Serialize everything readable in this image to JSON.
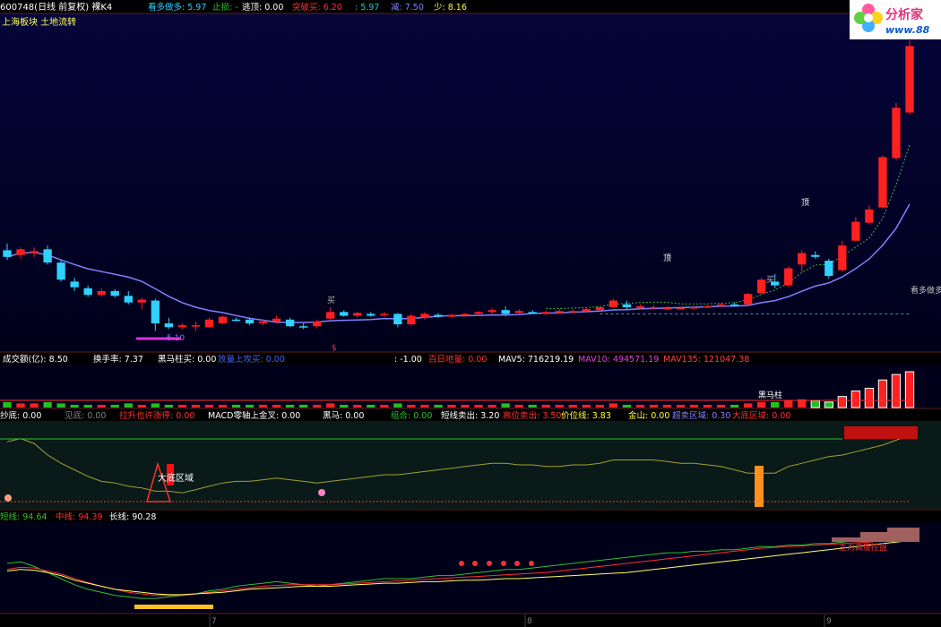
{
  "header": {
    "stock": "600748(日线 前复权) 裸K4",
    "items": [
      {
        "text": "看多做多: 5.97",
        "color": "#30d0ff"
      },
      {
        "text": "止损: -",
        "color": "#30c030"
      },
      {
        "text": "逃顶: 0.00",
        "color": "#ffffff"
      },
      {
        "text": "突破买: 6.20",
        "color": "#ff3030"
      },
      {
        "text": ": 5.97",
        "color": "#30c0c0"
      },
      {
        "text": "减: 7.50",
        "color": "#8080ff"
      },
      {
        "text": "少: 8.16",
        "color": "#ffff40"
      }
    ],
    "sector": "上海板块 土地流转"
  },
  "logo": {
    "line1": "分析家",
    "line2": "www.88"
  },
  "main_annotations": {
    "low_label": "5.10",
    "right_label": "看多做多",
    "top_label": "顶",
    "top_label2": "顶",
    "buy_label": "买",
    "buy_label2": "买",
    "sell_mark": "$"
  },
  "volume_header": [
    {
      "text": "成交额(亿): 8.50",
      "color": "#ffffff"
    },
    {
      "text": "换手率: 7.37",
      "color": "#ffffff"
    },
    {
      "text": "黑马柱买: 0.00",
      "color": "#ffffff"
    },
    {
      "text": "放量上攻买: 0.00",
      "color": "#4060ff"
    },
    {
      "text": ": -1.00",
      "color": "#ffffff"
    },
    {
      "text": "百日地量: 0.00",
      "color": "#ff3030"
    },
    {
      "text": "MAV5: 716219.19",
      "color": "#ffffff"
    },
    {
      "text": "MAV10: 494571.19",
      "color": "#e040e0"
    },
    {
      "text": "MAV135: 121047.38",
      "color": "#ff4040"
    }
  ],
  "volume_annotation": "黑马柱",
  "ind1_header": [
    {
      "text": "抄底: 0.00",
      "color": "#ffffff"
    },
    {
      "text": "见底: 0.00",
      "color": "#808080"
    },
    {
      "text": "拉升也许涨停: 0.00",
      "color": "#ff3030"
    },
    {
      "text": "MACD零轴上金叉: 0.00",
      "color": "#ffffff"
    },
    {
      "text": "黑马: 0.00",
      "color": "#ffffff"
    },
    {
      "text": "组合: 0.00",
      "color": "#30c030"
    },
    {
      "text": "短线卖出: 3.20",
      "color": "#ffffff"
    },
    {
      "text": "高位卖出: 3.50",
      "color": "#ff3030"
    },
    {
      "text": "价位线: 3.83",
      "color": "#ffff40"
    },
    {
      "text": "金山: 0.00",
      "color": "#ffff40"
    },
    {
      "text": "超卖区域: 0.30",
      "color": "#8080ff"
    },
    {
      "text": "大底区域: 0.00",
      "color": "#ff3030"
    }
  ],
  "ind1_annotation": "大底区域",
  "ind2_header": [
    {
      "text": "短线: 94.64",
      "color": "#30c030"
    },
    {
      "text": "中线: 94.39",
      "color": "#ff3030"
    },
    {
      "text": "长线: 90.28",
      "color": "#ffffff"
    }
  ],
  "ind2_annotation": "主力高度控盘",
  "date_ticks": [
    "7",
    "8",
    "9"
  ],
  "colors": {
    "up": "#ff2020",
    "down": "#30d0ff",
    "ma": "#8080ff",
    "bg_top": "#00003a",
    "bg_bottom": "#000000"
  },
  "chart_data": {
    "type": "candlestick",
    "ohlc": [
      [
        5.95,
        6.02,
        5.85,
        5.88
      ],
      [
        5.9,
        5.98,
        5.86,
        5.96
      ],
      [
        5.92,
        5.98,
        5.88,
        5.94
      ],
      [
        5.96,
        6.0,
        5.8,
        5.82
      ],
      [
        5.82,
        5.85,
        5.62,
        5.64
      ],
      [
        5.62,
        5.66,
        5.52,
        5.56
      ],
      [
        5.55,
        5.58,
        5.46,
        5.48
      ],
      [
        5.48,
        5.55,
        5.46,
        5.52
      ],
      [
        5.52,
        5.54,
        5.45,
        5.47
      ],
      [
        5.47,
        5.52,
        5.38,
        5.4
      ],
      [
        5.4,
        5.45,
        5.33,
        5.43
      ],
      [
        5.42,
        5.44,
        5.1,
        5.18
      ],
      [
        5.18,
        5.24,
        5.12,
        5.14
      ],
      [
        5.14,
        5.18,
        5.12,
        5.16
      ],
      [
        5.16,
        5.2,
        5.1,
        5.16
      ],
      [
        5.14,
        5.24,
        5.13,
        5.22
      ],
      [
        5.18,
        5.26,
        5.17,
        5.25
      ],
      [
        5.22,
        5.24,
        5.2,
        5.21
      ],
      [
        5.22,
        5.24,
        5.16,
        5.18
      ],
      [
        5.18,
        5.22,
        5.16,
        5.2
      ],
      [
        5.2,
        5.26,
        5.18,
        5.23
      ],
      [
        5.22,
        5.24,
        5.14,
        5.15
      ],
      [
        5.15,
        5.18,
        5.12,
        5.14
      ],
      [
        5.15,
        5.22,
        5.13,
        5.2
      ],
      [
        5.23,
        5.35,
        5.22,
        5.3
      ],
      [
        5.3,
        5.32,
        5.25,
        5.26
      ],
      [
        5.26,
        5.3,
        5.24,
        5.29
      ],
      [
        5.28,
        5.3,
        5.25,
        5.26
      ],
      [
        5.27,
        5.3,
        5.25,
        5.28
      ],
      [
        5.28,
        5.29,
        5.14,
        5.17
      ],
      [
        5.17,
        5.28,
        5.16,
        5.26
      ],
      [
        5.24,
        5.3,
        5.22,
        5.28
      ],
      [
        5.27,
        5.29,
        5.24,
        5.25
      ],
      [
        5.25,
        5.28,
        5.24,
        5.27
      ],
      [
        5.26,
        5.29,
        5.25,
        5.28
      ],
      [
        5.28,
        5.31,
        5.26,
        5.3
      ],
      [
        5.3,
        5.34,
        5.28,
        5.32
      ],
      [
        5.32,
        5.36,
        5.26,
        5.28
      ],
      [
        5.29,
        5.33,
        5.27,
        5.31
      ],
      [
        5.3,
        5.32,
        5.28,
        5.29
      ],
      [
        5.28,
        5.31,
        5.27,
        5.3
      ],
      [
        5.29,
        5.33,
        5.28,
        5.31
      ],
      [
        5.3,
        5.33,
        5.29,
        5.31
      ],
      [
        5.31,
        5.34,
        5.3,
        5.33
      ],
      [
        5.32,
        5.36,
        5.31,
        5.35
      ],
      [
        5.35,
        5.44,
        5.34,
        5.42
      ],
      [
        5.38,
        5.42,
        5.32,
        5.35
      ],
      [
        5.34,
        5.38,
        5.33,
        5.36
      ],
      [
        5.35,
        5.37,
        5.33,
        5.35
      ],
      [
        5.34,
        5.36,
        5.32,
        5.34
      ],
      [
        5.34,
        5.35,
        5.33,
        5.34
      ],
      [
        5.34,
        5.36,
        5.33,
        5.35
      ],
      [
        5.35,
        5.37,
        5.34,
        5.36
      ],
      [
        5.36,
        5.39,
        5.35,
        5.38
      ],
      [
        5.38,
        5.4,
        5.36,
        5.37
      ],
      [
        5.38,
        5.5,
        5.37,
        5.49
      ],
      [
        5.5,
        5.66,
        5.48,
        5.64
      ],
      [
        5.62,
        5.7,
        5.55,
        5.58
      ],
      [
        5.58,
        5.78,
        5.56,
        5.76
      ],
      [
        5.8,
        5.95,
        5.72,
        5.92
      ],
      [
        5.9,
        5.94,
        5.86,
        5.88
      ],
      [
        5.84,
        5.86,
        5.65,
        5.68
      ],
      [
        5.74,
        6.05,
        5.72,
        6.0
      ],
      [
        6.05,
        6.3,
        6.04,
        6.25
      ],
      [
        6.24,
        6.42,
        6.22,
        6.38
      ],
      [
        6.4,
        6.95,
        6.39,
        6.93
      ],
      [
        6.92,
        7.5,
        6.9,
        7.45
      ],
      [
        7.4,
        8.16,
        7.38,
        8.1
      ]
    ],
    "price_range": [
      5.1,
      8.16
    ]
  },
  "volume_data": [
    4,
    3,
    3,
    4,
    3,
    2,
    2,
    2,
    2,
    3,
    2,
    3,
    2,
    2,
    2,
    2,
    2,
    2,
    2,
    2,
    2,
    2,
    2,
    2,
    3,
    2,
    2,
    2,
    2,
    3,
    2,
    2,
    2,
    2,
    2,
    2,
    2,
    3,
    2,
    2,
    2,
    2,
    2,
    2,
    2,
    3,
    2,
    2,
    2,
    2,
    2,
    2,
    2,
    2,
    2,
    3,
    4,
    4,
    5,
    6,
    5,
    4,
    8,
    12,
    14,
    20,
    24,
    26
  ],
  "ind1_line": [
    78,
    82,
    76,
    62,
    52,
    44,
    36,
    30,
    28,
    24,
    22,
    18,
    18,
    16,
    20,
    24,
    28,
    30,
    30,
    32,
    34,
    32,
    30,
    28,
    30,
    32,
    34,
    36,
    38,
    38,
    40,
    42,
    44,
    46,
    48,
    50,
    52,
    52,
    50,
    50,
    48,
    48,
    50,
    50,
    52,
    56,
    56,
    56,
    56,
    54,
    52,
    52,
    50,
    48,
    44,
    40,
    40,
    40,
    48,
    52,
    56,
    60,
    62,
    66,
    70,
    74,
    80,
    86
  ],
  "ind2_short": [
    60,
    62,
    56,
    48,
    40,
    32,
    26,
    22,
    18,
    16,
    14,
    14,
    16,
    18,
    20,
    24,
    26,
    30,
    32,
    34,
    36,
    34,
    32,
    30,
    32,
    34,
    36,
    38,
    40,
    40,
    40,
    42,
    44,
    44,
    46,
    48,
    50,
    52,
    52,
    54,
    56,
    58,
    60,
    62,
    64,
    66,
    68,
    70,
    72,
    74,
    74,
    76,
    76,
    78,
    78,
    80,
    82,
    82,
    84,
    84,
    86,
    86,
    88,
    90,
    92,
    93,
    94,
    95
  ],
  "ind2_mid": [
    52,
    55,
    54,
    50,
    46,
    40,
    35,
    30,
    26,
    22,
    20,
    18,
    18,
    18,
    20,
    22,
    24,
    26,
    28,
    30,
    31,
    32,
    32,
    32,
    32,
    33,
    34,
    35,
    36,
    37,
    38,
    39,
    40,
    41,
    42,
    43,
    44,
    45,
    46,
    47,
    48,
    50,
    52,
    54,
    56,
    58,
    60,
    62,
    64,
    66,
    68,
    70,
    72,
    74,
    76,
    78,
    80,
    81,
    82,
    83,
    84,
    85,
    86,
    87,
    88,
    90,
    92,
    94
  ],
  "ind2_long": [
    50,
    52,
    51,
    48,
    44,
    38,
    34,
    30,
    26,
    24,
    22,
    20,
    19,
    19,
    20,
    21,
    22,
    24,
    26,
    27,
    28,
    29,
    30,
    30,
    30,
    31,
    32,
    33,
    34,
    34,
    35,
    36,
    36,
    37,
    38,
    38,
    39,
    40,
    40,
    41,
    42,
    43,
    44,
    45,
    46,
    47,
    48,
    50,
    52,
    54,
    56,
    58,
    60,
    62,
    64,
    66,
    68,
    70,
    72,
    74,
    76,
    78,
    80,
    82,
    84,
    86,
    88,
    90
  ]
}
